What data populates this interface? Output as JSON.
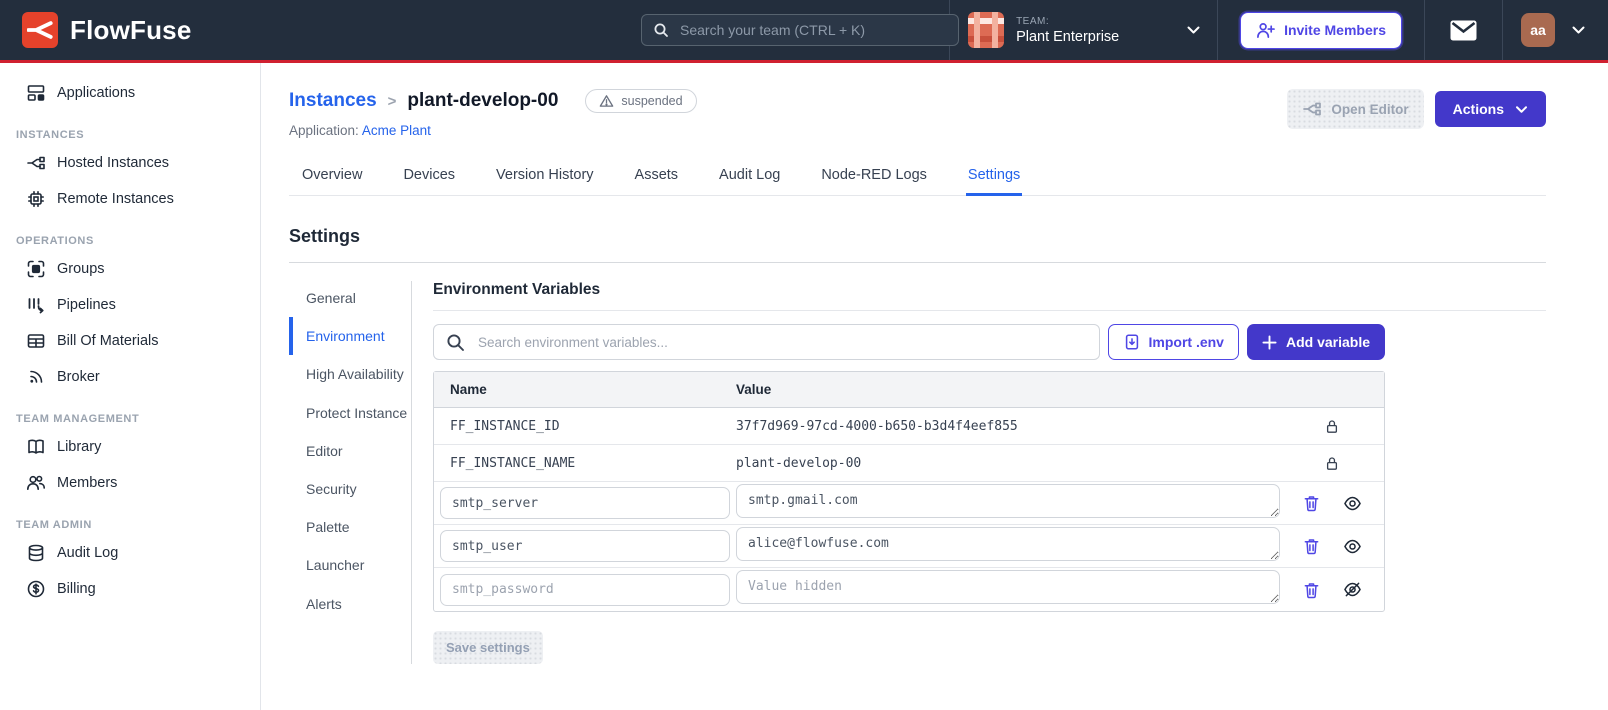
{
  "navbar": {
    "brand": "FlowFuse",
    "search_placeholder": "Search your team (CTRL + K)",
    "team_label": "TEAM:",
    "team_name": "Plant Enterprise",
    "invite_button": "Invite Members",
    "avatar_initials": "aa"
  },
  "sidebar": {
    "sections": [
      {
        "header": "",
        "items": [
          {
            "label": "Applications"
          }
        ]
      },
      {
        "header": "INSTANCES",
        "items": [
          {
            "label": "Hosted Instances"
          },
          {
            "label": "Remote Instances"
          }
        ]
      },
      {
        "header": "OPERATIONS",
        "items": [
          {
            "label": "Groups"
          },
          {
            "label": "Pipelines"
          },
          {
            "label": "Bill Of Materials"
          },
          {
            "label": "Broker"
          }
        ]
      },
      {
        "header": "TEAM MANAGEMENT",
        "items": [
          {
            "label": "Library"
          },
          {
            "label": "Members"
          }
        ]
      },
      {
        "header": "TEAM ADMIN",
        "items": [
          {
            "label": "Audit Log"
          },
          {
            "label": "Billing"
          }
        ]
      }
    ]
  },
  "header": {
    "breadcrumb_parent": "Instances",
    "breadcrumb_separator": ">",
    "instance_name": "plant-develop-00",
    "status_badge": "suspended",
    "application_label": "Application:",
    "application_name": "Acme Plant",
    "open_editor_button": "Open Editor",
    "actions_button": "Actions"
  },
  "tabs": {
    "items": [
      {
        "label": "Overview"
      },
      {
        "label": "Devices"
      },
      {
        "label": "Version History"
      },
      {
        "label": "Assets"
      },
      {
        "label": "Audit Log"
      },
      {
        "label": "Node-RED Logs"
      },
      {
        "label": "Settings",
        "active": true
      }
    ]
  },
  "settings": {
    "title": "Settings",
    "nav": {
      "items": [
        {
          "label": "General"
        },
        {
          "label": "Environment",
          "active": true
        },
        {
          "label": "High Availability"
        },
        {
          "label": "Protect Instance"
        },
        {
          "label": "Editor"
        },
        {
          "label": "Security"
        },
        {
          "label": "Palette"
        },
        {
          "label": "Launcher"
        },
        {
          "label": "Alerts"
        }
      ]
    },
    "env": {
      "title": "Environment Variables",
      "search_placeholder": "Search environment variables...",
      "import_button": "Import .env",
      "add_button": "Add variable",
      "columns": {
        "name": "Name",
        "value": "Value"
      },
      "locked_rows": [
        {
          "name": "FF_INSTANCE_ID",
          "value": "37f7d969-97cd-4000-b650-b3d4f4eef855"
        },
        {
          "name": "FF_INSTANCE_NAME",
          "value": "plant-develop-00"
        }
      ],
      "rows": [
        {
          "name": "smtp_server",
          "value": "smtp.gmail.com"
        },
        {
          "name": "smtp_user",
          "value": "alice@flowfuse.com"
        },
        {
          "name": "smtp_password",
          "value": "",
          "value_placeholder": "Value hidden"
        }
      ],
      "save_button": "Save settings"
    }
  },
  "icons": [
    "flowfuse-logo",
    "search-icon",
    "chevron-down-icon",
    "user-plus-icon",
    "mail-icon",
    "applications-icon",
    "hosted-instances-icon",
    "remote-instances-icon",
    "groups-icon",
    "pipelines-icon",
    "bill-of-materials-icon",
    "broker-icon",
    "library-icon",
    "members-icon",
    "audit-log-icon",
    "billing-icon",
    "warning-icon",
    "branch-icon",
    "import-icon",
    "plus-icon",
    "lock-icon",
    "trash-icon",
    "eye-icon",
    "eye-off-icon"
  ],
  "colors": {
    "navbar_bg": "#232e3d",
    "accent_red": "#d02030",
    "indigo": "#4338ca",
    "indigo_icon": "#4f46e5",
    "link_blue": "#2563eb",
    "logo_red": "#e5422b",
    "team_avatar": "#dd6b54",
    "user_avatar": "#a96a50"
  }
}
